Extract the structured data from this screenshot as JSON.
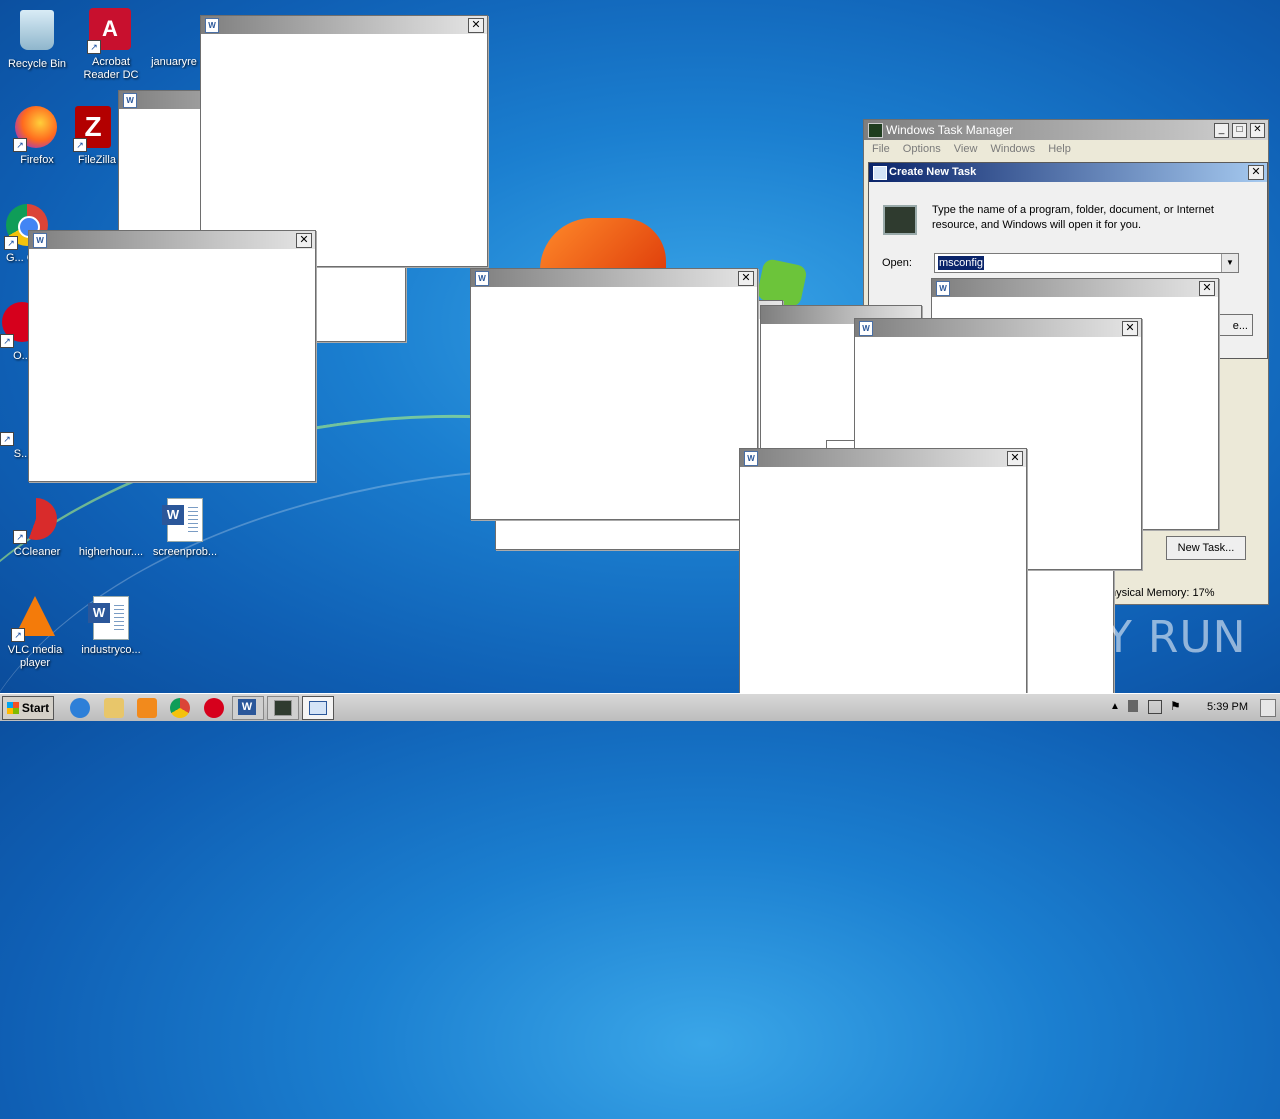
{
  "desktop": {
    "icons": [
      {
        "id": "recycle-bin",
        "label": "Recycle Bin"
      },
      {
        "id": "acrobat",
        "label": "Acrobat Reader DC"
      },
      {
        "id": "january",
        "label": "januaryre"
      },
      {
        "id": "firefox",
        "label": "Firefox"
      },
      {
        "id": "filezilla",
        "label": "FileZilla"
      },
      {
        "id": "chrome",
        "label": "G... Ch..."
      },
      {
        "id": "opera",
        "label": "O..."
      },
      {
        "id": "skype",
        "label": "S..."
      },
      {
        "id": "ccleaner",
        "label": "CCleaner"
      },
      {
        "id": "higherhour",
        "label": "higherhour...."
      },
      {
        "id": "screenprob",
        "label": "screenprob..."
      },
      {
        "id": "vlc",
        "label": "VLC media player"
      },
      {
        "id": "industryco",
        "label": "industryco..."
      }
    ],
    "watermark": "ANY RUN"
  },
  "task_manager": {
    "title": "Windows Task Manager",
    "menu": [
      "File",
      "Options",
      "View",
      "Windows",
      "Help"
    ],
    "new_task_button": "New Task...",
    "status": "hysical Memory: 17%"
  },
  "create_new_task": {
    "title": "Create New Task",
    "description": "Type the name of a program, folder, document, or Internet resource, and Windows will open it for you.",
    "open_label": "Open:",
    "open_value": "msconfig",
    "browse_button_fragment": "e..."
  },
  "taskbar": {
    "start_label": "Start",
    "clock": "5:39 PM"
  }
}
